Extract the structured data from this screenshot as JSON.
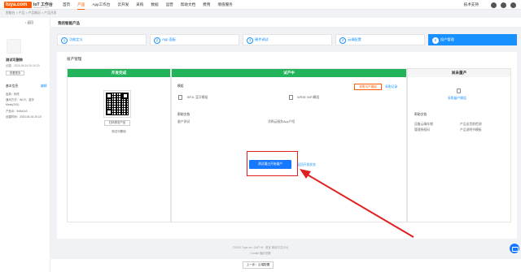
{
  "header": {
    "logo": "tuya.com",
    "platform": "IoT 工作台",
    "platform_sub": "Powered by tuya",
    "nav": [
      "首页",
      "产品",
      "App工作台",
      "云开发",
      "采购",
      "数据",
      "运营",
      "帮助文档",
      "费用",
      "增值服务"
    ],
    "active_nav": "产品",
    "support": "技术支持"
  },
  "breadcrumb": "智能台 > 产品 > 产品概况 > 产品开发",
  "subheader": {
    "title": "我的智能产品"
  },
  "sidebar": {
    "back": "‹ 返回",
    "product_name": "测试可删除",
    "created": "创建：2020-06-16 20:10:20",
    "switch_btn": "查看更多",
    "info_title": "基本信息",
    "edit": "编辑",
    "lines": [
      "品类：网关",
      "通讯方式：Wi-Fi，蓝牙",
      "Mesh(SIG)",
      "产品ID：fb4fa2x3",
      "创建时间：2020-06-16 20:10"
    ]
  },
  "steps": [
    {
      "num": "1",
      "label": "功能定义",
      "sub": ""
    },
    {
      "num": "2",
      "label": "App 面板",
      "sub": ""
    },
    {
      "num": "3",
      "label": "硬件调试",
      "sub": ""
    },
    {
      "num": "4",
      "label": "云端配置",
      "sub": ""
    },
    {
      "num": "5",
      "label": "投产管理",
      "sub": ""
    }
  ],
  "content": {
    "section_title": "投产管理",
    "col1": {
      "head": "开发完成",
      "qr_btn": "扫码预览产品",
      "qr_label": "测试可删除"
    },
    "col2": {
      "head": "试产中",
      "modules_label": "模组",
      "buy_btn": "采购试产模组",
      "buy_record": "采购记录",
      "module1": "BP2L 蓝牙模组",
      "module2": "WR3E WiFi模组",
      "help_label": "帮助文档",
      "help1": "量产测试",
      "help2": "涂鸦云服务App介绍",
      "primary_btn": "测试通过开始量产",
      "link": "返回开发状态"
    },
    "col3": {
      "head": "尚未量产",
      "buy_link": "采购量产模组",
      "help_label": "帮助文档",
      "help1": "设备云端存储",
      "help2": "产品出货前检测",
      "help3": "管理授权码",
      "help4": "产品说明书模板"
    }
  },
  "footer": {
    "line1": "©2020 Tuya Inc.   GMT+8   ·   语言   简体中文(ZH)",
    "line2": "Cookie 偏好设置"
  },
  "bottom": {
    "prev": "上一步：云端配置"
  },
  "colors": {
    "brand": "#ff5a00",
    "primary": "#1677ff",
    "green": "#23b35a",
    "annotation": "#e02020"
  }
}
